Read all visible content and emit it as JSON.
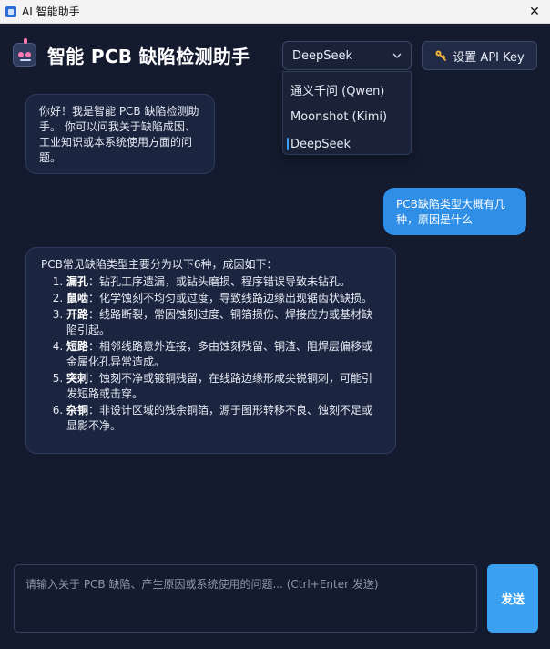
{
  "window": {
    "title": "AI 智能助手",
    "close_glyph": "✕"
  },
  "header": {
    "title": "智能 PCB 缺陷检测助手",
    "icon": "robot-icon"
  },
  "model_select": {
    "selected": "DeepSeek",
    "options": [
      "通义千问 (Qwen)",
      "Moonshot (Kimi)",
      "DeepSeek"
    ]
  },
  "api_button": {
    "label": "设置 API Key",
    "icon": "key-icon"
  },
  "messages": [
    {
      "role": "assistant",
      "text": "你好！我是智能 PCB 缺陷检测助手。 你可以问我关于缺陷成因、工业知识或本系统使用方面的问题。"
    },
    {
      "role": "user",
      "text": "PCB缺陷类型大概有几种，原因是什么"
    },
    {
      "role": "assistant",
      "intro": "PCB常见缺陷类型主要分为以下6种，成因如下：",
      "items": [
        {
          "term": "漏孔",
          "desc": "：钻孔工序遗漏，或钻头磨损、程序错误导致未钻孔。"
        },
        {
          "term": "鼠啮",
          "desc": "：化学蚀刻不均匀或过度，导致线路边缘出现锯齿状缺损。"
        },
        {
          "term": "开路",
          "desc": "：线路断裂，常因蚀刻过度、铜箔损伤、焊接应力或基材缺陷引起。"
        },
        {
          "term": "短路",
          "desc": "：相邻线路意外连接，多由蚀刻残留、铜渣、阻焊层偏移或金属化孔异常造成。"
        },
        {
          "term": "突刺",
          "desc": "：蚀刻不净或镀铜残留，在线路边缘形成尖锐铜刺，可能引发短路或击穿。"
        },
        {
          "term": "杂铜",
          "desc": "：非设计区域的残余铜箔，源于图形转移不良、蚀刻不足或显影不净。"
        }
      ]
    }
  ],
  "input": {
    "value": "",
    "placeholder": "请输入关于 PCB 缺陷、产生原因或系统使用的问题... (Ctrl+Enter 发送)"
  },
  "send_button": {
    "label": "发送"
  },
  "colors": {
    "background": "#141b2f",
    "user_bubble": "#2f8fe6",
    "accent": "#3aa0ef"
  }
}
